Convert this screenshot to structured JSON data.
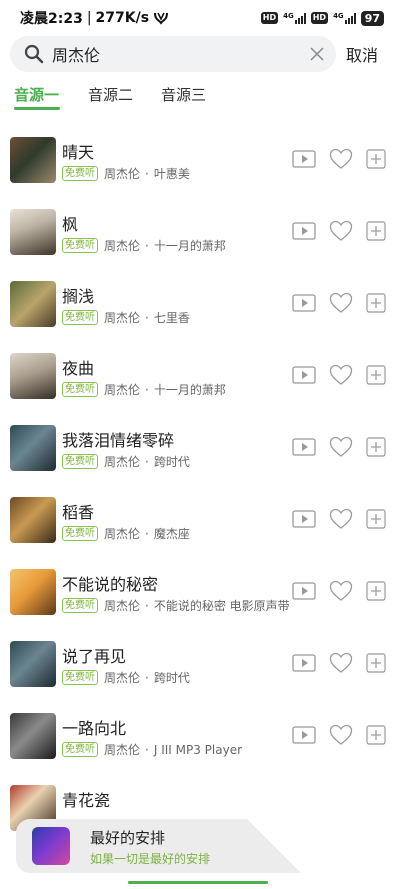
{
  "status": {
    "time": "凌晨2:23",
    "speed": "277K/s",
    "network": "4G",
    "battery": "97",
    "hd": "HD"
  },
  "search": {
    "value": "周杰伦",
    "placeholder": "",
    "cancel_label": "取消"
  },
  "tabs": [
    {
      "label": "音源一",
      "active": true
    },
    {
      "label": "音源二",
      "active": false
    },
    {
      "label": "音源三",
      "active": false
    }
  ],
  "free_badge": "免费听",
  "songs": [
    {
      "title": "晴天",
      "artist": "周杰伦",
      "album": "叶惠美"
    },
    {
      "title": "枫",
      "artist": "周杰伦",
      "album": "十一月的萧邦"
    },
    {
      "title": "搁浅",
      "artist": "周杰伦",
      "album": "七里香"
    },
    {
      "title": "夜曲",
      "artist": "周杰伦",
      "album": "十一月的萧邦"
    },
    {
      "title": "我落泪情绪零碎",
      "artist": "周杰伦",
      "album": "跨时代"
    },
    {
      "title": "稻香",
      "artist": "周杰伦",
      "album": "魔杰座"
    },
    {
      "title": "不能说的秘密",
      "artist": "周杰伦",
      "album": "不能说的秘密 电影原声带"
    },
    {
      "title": "说了再见",
      "artist": "周杰伦",
      "album": "跨时代"
    },
    {
      "title": "一路向北",
      "artist": "周杰伦",
      "album": "J III MP3 Player"
    },
    {
      "title": "青花瓷",
      "artist": "",
      "album": ""
    }
  ],
  "player": {
    "title": "最好的安排",
    "subtitle": "如果一切是最好的安排"
  },
  "colors": {
    "accent": "#4caf50",
    "badge": "#7cb342"
  }
}
